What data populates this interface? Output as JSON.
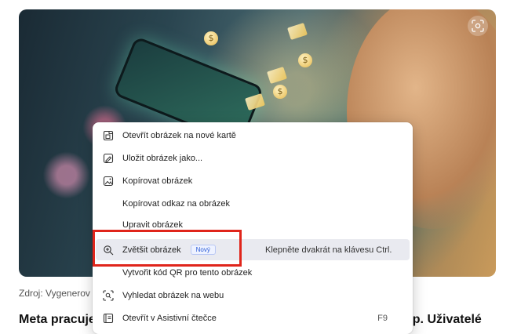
{
  "photo": {
    "alt_coin_symbol": "$"
  },
  "caption": {
    "text": "Zdroj: Vygenerov"
  },
  "headline": {
    "left_text": "Meta pracuje",
    "right_text": "op. Uživatelé"
  },
  "context_menu": {
    "items": [
      {
        "label": "Otevřít obrázek na nové kartě",
        "icon": "open-in-new-tab-icon"
      },
      {
        "label": "Uložit obrázek jako...",
        "icon": "save-image-icon"
      },
      {
        "label": "Kopírovat obrázek",
        "icon": "copy-image-icon"
      },
      {
        "label": "Kopírovat odkaz na obrázek",
        "icon": ""
      },
      {
        "label": "Upravit obrázek",
        "icon": ""
      },
      {
        "label": "Zvětšit obrázek",
        "icon": "zoom-in-icon",
        "badge": "Nový",
        "hint": "Klepněte dvakrát na klávesu Ctrl."
      },
      {
        "label": "Vytvořit kód QR pro tento obrázek",
        "icon": ""
      },
      {
        "label": "Vyhledat obrázek na webu",
        "icon": "visual-search-icon"
      },
      {
        "label": "Otevřít v Asistivní čtečce",
        "icon": "immersive-reader-icon",
        "shortcut": "F9"
      }
    ]
  },
  "colors": {
    "highlight": "#e9eaf0",
    "annotation_box": "#e0251b",
    "badge": "#2a5bd7"
  }
}
